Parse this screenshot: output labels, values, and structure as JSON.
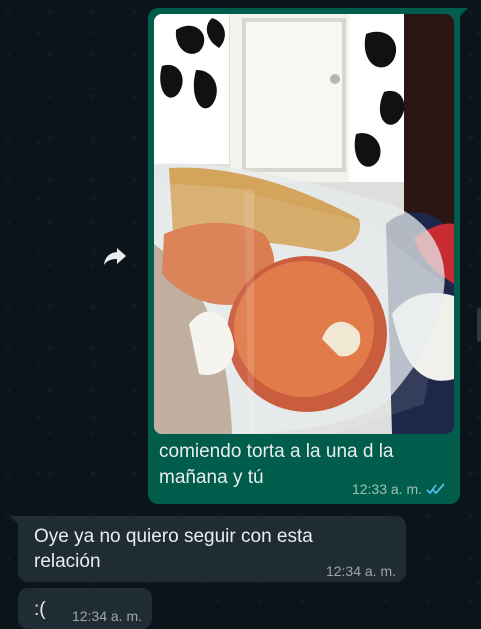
{
  "conversation": {
    "outgoing": {
      "caption": "comiendo torta a la una d la mañana y tú",
      "time": "12:33 a. m.",
      "status_icon": "double-check-read-icon",
      "bubble_color": "#005c4b",
      "read_check_color": "#53bdeb"
    },
    "incoming": [
      {
        "text": "Oye ya no quiero seguir con esta relación",
        "time": "12:34 a. m."
      },
      {
        "text": ":(",
        "time": "12:34 a. m."
      }
    ]
  },
  "controls": {
    "forward_icon": "forward-arrow-icon"
  },
  "theme": {
    "background": "#0b141a",
    "incoming_bubble": "#202c33",
    "text": "#e9edef"
  }
}
